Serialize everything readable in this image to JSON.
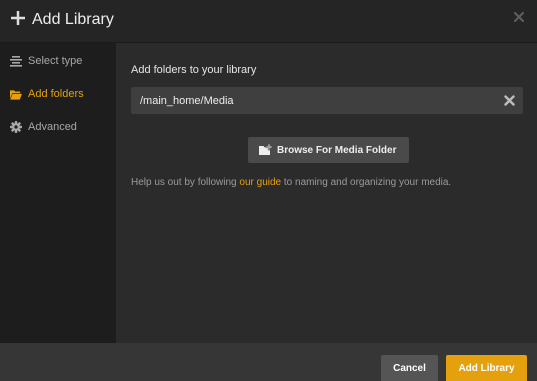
{
  "dialog": {
    "title": "Add Library",
    "header_icon": "plus-icon",
    "close_icon": "close-icon"
  },
  "sidebar": {
    "items": [
      {
        "label": "Select type",
        "icon": "list-icon",
        "active": false
      },
      {
        "label": "Add folders",
        "icon": "folder-open-icon",
        "active": true
      },
      {
        "label": "Advanced",
        "icon": "gear-icon",
        "active": false
      }
    ]
  },
  "main": {
    "section_title": "Add folders to your library",
    "folder_path": {
      "value": "/main_home/Media",
      "clear_icon": "clear-icon"
    },
    "browse_button": {
      "label": "Browse For Media Folder",
      "icon": "folder-plus-icon"
    },
    "help": {
      "before": "Help us out by following ",
      "link": "our guide",
      "after": " to naming and organizing your media."
    }
  },
  "footer": {
    "cancel_label": "Cancel",
    "add_label": "Add Library"
  },
  "colors": {
    "accent": "#e5a00d",
    "header_bg": "#252525",
    "sidebar_bg": "#1d1d1d",
    "content_bg": "#2b2b2b",
    "footer_bg": "#363636"
  }
}
